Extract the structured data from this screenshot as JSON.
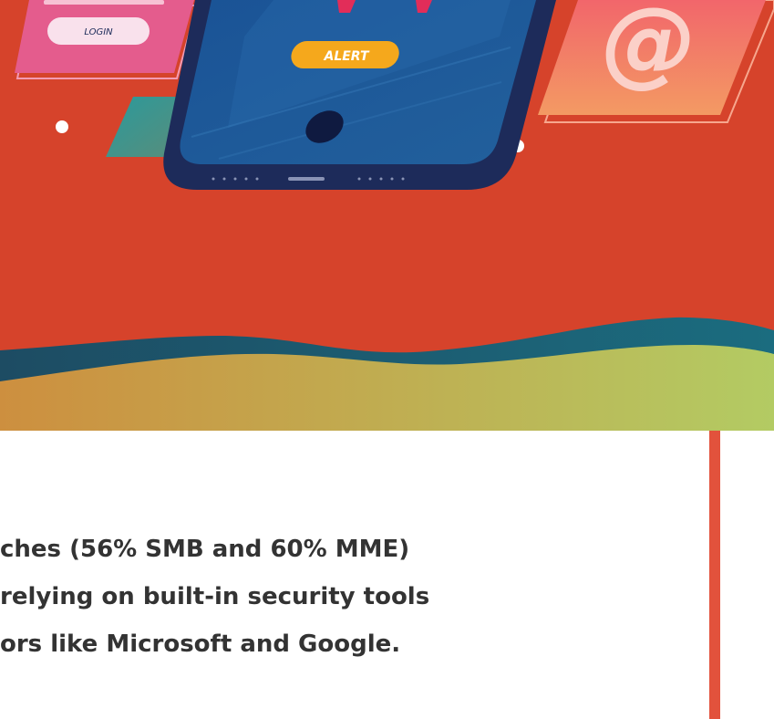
{
  "hero": {
    "login_label": "LOGIN",
    "alert_label": "ALERT",
    "email_symbol": "@",
    "colors": {
      "background": "#d6432b",
      "phone_body": "#1d2b5a",
      "screen": "#1f62a3",
      "alert_pill": "#f5a81c",
      "login_card": "#e45c8d",
      "email_card": "#f2776a",
      "wave_dark": "#1b5c72",
      "wave_gradient_start": "#cd8f3f",
      "wave_gradient_end": "#b3cb63"
    }
  },
  "body_text": {
    "line1_prefix": "ches ",
    "line1_emphasis": "(56% SMB and 60% MME)",
    "line2": "relying on built-in security tools",
    "line3": "ors like Microsoft and Google."
  },
  "accent_color": "#e2523c"
}
